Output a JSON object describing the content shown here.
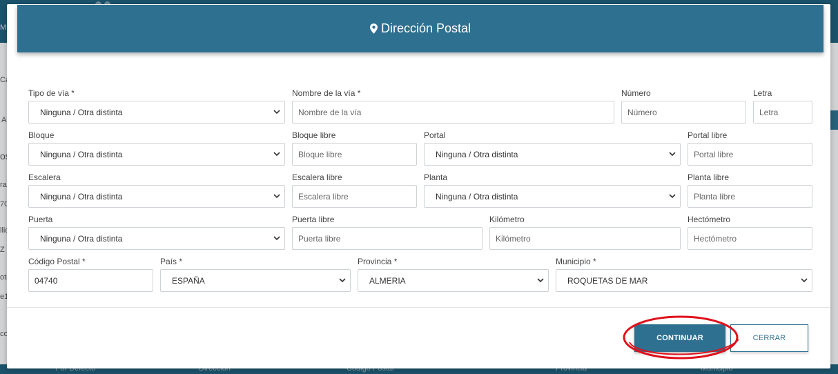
{
  "background": {
    "user_label": "MI PE",
    "fragments": [
      "Ca",
      "A",
      "os",
      "rac",
      "70",
      "llid",
      "Z",
      "otr",
      "e1",
      "co"
    ],
    "footer_columns": [
      "Por Defecto",
      "Dirección",
      "Código Postal",
      "Provincia",
      "Municipio"
    ]
  },
  "modal": {
    "title": "Dirección Postal",
    "header_icon": "map-marker-icon",
    "colors": {
      "header": "#2e7090",
      "annotation": "#e0101b"
    },
    "fields": {
      "tipo_via": {
        "label": "Tipo de vía *",
        "value": "Ninguna / Otra distinta"
      },
      "nombre_via": {
        "label": "Nombre de la vía *",
        "placeholder": "Nombre de la vía"
      },
      "numero": {
        "label": "Número",
        "placeholder": "Número"
      },
      "letra": {
        "label": "Letra",
        "placeholder": "Letra"
      },
      "bloque": {
        "label": "Bloque",
        "value": "Ninguna / Otra distinta"
      },
      "bloque_libre": {
        "label": "Bloque libre",
        "placeholder": "Bloque libre"
      },
      "portal": {
        "label": "Portal",
        "value": "Ninguna / Otra distinta"
      },
      "portal_libre": {
        "label": "Portal libre",
        "placeholder": "Portal libre"
      },
      "escalera": {
        "label": "Escalera",
        "value": "Ninguna / Otra distinta"
      },
      "escalera_libre": {
        "label": "Escalera libre",
        "placeholder": "Escalera libre"
      },
      "planta": {
        "label": "Planta",
        "value": "Ninguna / Otra distinta"
      },
      "planta_libre": {
        "label": "Planta libre",
        "placeholder": "Planta libre"
      },
      "puerta": {
        "label": "Puerta",
        "value": "Ninguna / Otra distinta"
      },
      "puerta_libre": {
        "label": "Puerta libre",
        "placeholder": "Puerta libre"
      },
      "kilometro": {
        "label": "Kilómetro",
        "placeholder": "Kilómetro"
      },
      "hectometro": {
        "label": "Hectómetro",
        "placeholder": "Hectómetro"
      },
      "codigo_postal": {
        "label": "Código Postal *",
        "value": "04740"
      },
      "pais": {
        "label": "País *",
        "value": "ESPAÑA"
      },
      "provincia": {
        "label": "Provincia *",
        "value": "ALMERIA"
      },
      "municipio": {
        "label": "Municipio *",
        "value": "ROQUETAS DE MAR"
      }
    },
    "buttons": {
      "continuar": "CONTINUAR",
      "cerrar": "CERRAR"
    }
  }
}
